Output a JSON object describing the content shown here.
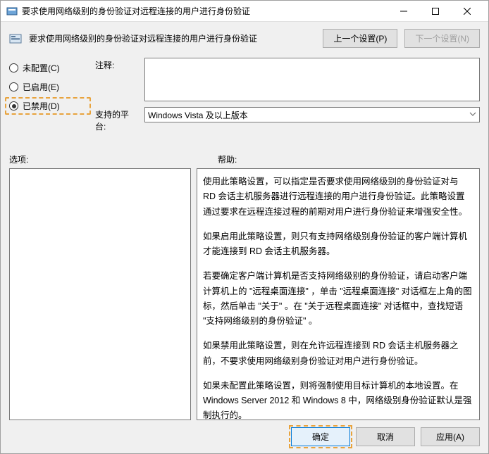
{
  "window": {
    "title": "要求使用网络级别的身份验证对远程连接的用户进行身份验证"
  },
  "header": {
    "policy_name": "要求使用网络级别的身份验证对远程连接的用户进行身份验证",
    "prev_setting": "上一个设置(P)",
    "next_setting": "下一个设置(N)"
  },
  "radios": {
    "not_configured": "未配置(C)",
    "enabled": "已启用(E)",
    "disabled": "已禁用(D)",
    "selected": "disabled"
  },
  "fields": {
    "comment_label": "注释:",
    "comment_value": "",
    "platform_label": "支持的平台:",
    "platform_value": "Windows Vista 及以上版本"
  },
  "sections": {
    "options_label": "选项:",
    "help_label": "帮助:"
  },
  "help": {
    "p1": "使用此策略设置，可以指定是否要求使用网络级别的身份验证对与 RD 会话主机服务器进行远程连接的用户进行身份验证。此策略设置通过要求在远程连接过程的前期对用户进行身份验证来增强安全性。",
    "p2": "如果启用此策略设置，则只有支持网络级别身份验证的客户端计算机才能连接到 RD 会话主机服务器。",
    "p3": "若要确定客户端计算机是否支持网络级别的身份验证，请启动客户端计算机上的 \"远程桌面连接\" ，单击 \"远程桌面连接\" 对话框左上角的图标，然后单击 \"关于\" 。在 \"关于远程桌面连接\" 对话框中，查找短语 \"支持网络级别的身份验证\" 。",
    "p4": "如果禁用此策略设置，则在允许远程连接到 RD 会话主机服务器之前，不要求使用网络级别身份验证对用户进行身份验证。",
    "p5": "如果未配置此策略设置，则将强制使用目标计算机的本地设置。在 Windows Server 2012 和 Windows 8 中，网络级别身份验证默认是强制执行的。"
  },
  "footer": {
    "ok": "确定",
    "cancel": "取消",
    "apply": "应用(A)"
  }
}
